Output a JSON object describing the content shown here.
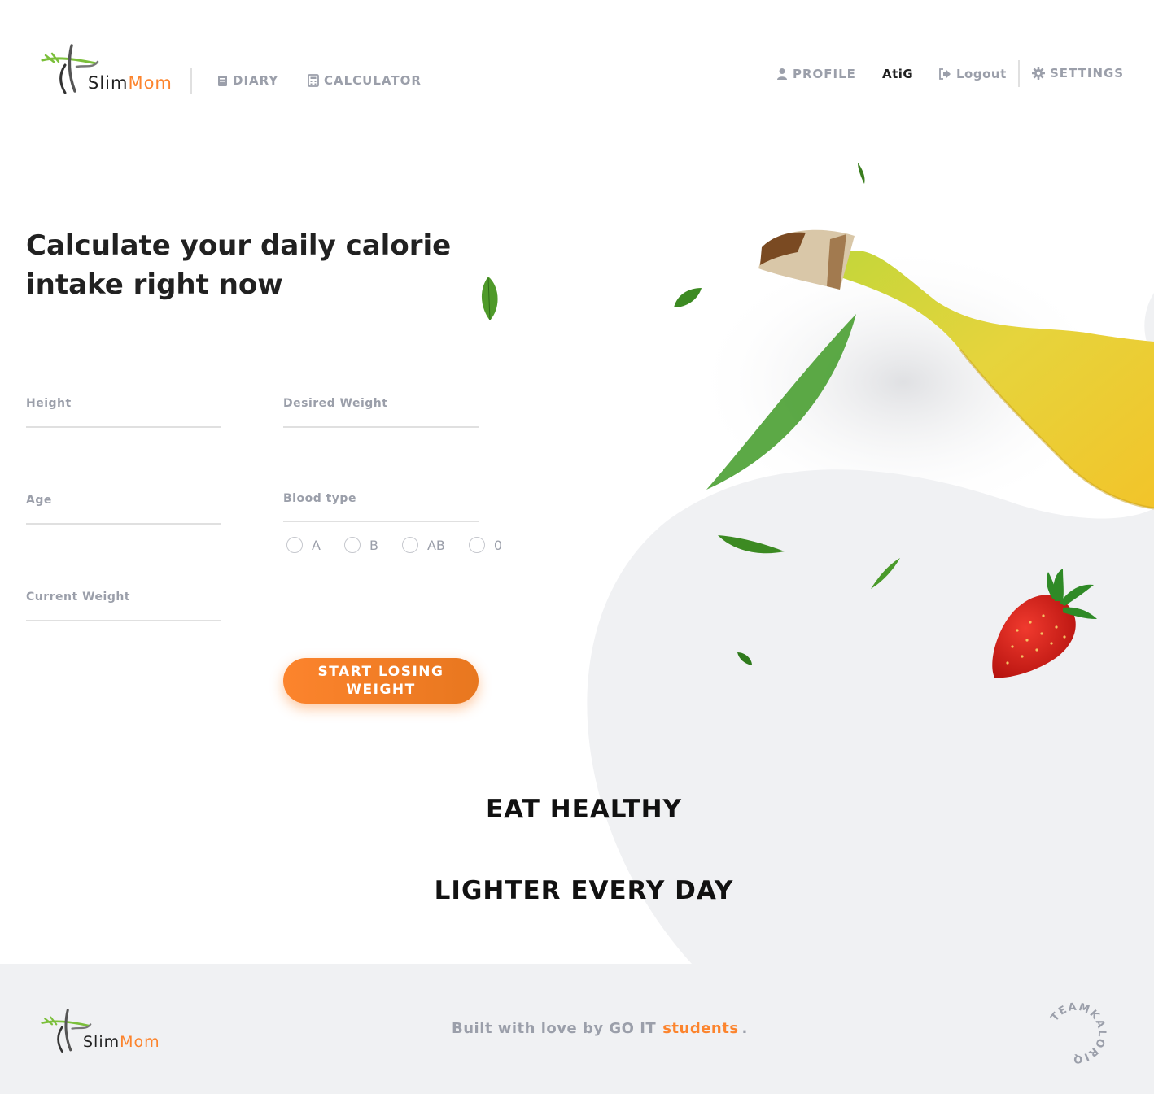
{
  "brand": {
    "name_part1": "Slim",
    "name_part2": "Mom",
    "accent_color": "#fc842d",
    "text_color": "#212121",
    "muted_color": "#9b9faa"
  },
  "nav_left": {
    "diary": {
      "label": "DIARY",
      "icon": "book-icon"
    },
    "calculator": {
      "label": "CALCULATOR",
      "icon": "calculator-icon"
    }
  },
  "nav_right": {
    "profile": {
      "label": "PROFILE",
      "icon": "user-icon"
    },
    "username": "AtiG",
    "logout": {
      "label": "Logout",
      "icon": "sign-out-icon"
    },
    "settings": {
      "label": "SETTINGS",
      "icon": "gear-icon"
    }
  },
  "main": {
    "title": "Calculate your daily calorie intake right now",
    "form": {
      "height_label": "Height",
      "desired_weight_label": "Desired Weight",
      "age_label": "Age",
      "blood_type_label": "Blood type",
      "current_weight_label": "Current Weight",
      "blood_types": [
        "A",
        "B",
        "AB",
        "0"
      ],
      "submit_label": "START LOSING WEIGHT"
    }
  },
  "slogans": [
    "EAT HEALTHY",
    "LIGHTER EVERY DAY"
  ],
  "footer": {
    "text": "Built with love by GO IT",
    "link": "students",
    "suffix": ".",
    "team_logo_text": "TEAMKALORIQ"
  }
}
